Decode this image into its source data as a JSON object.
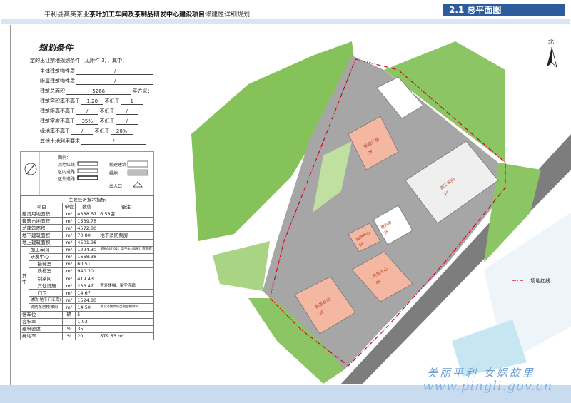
{
  "header": {
    "title_pre": "平利县高英茶业",
    "title_bold": "茶叶加工车间及茶制品研发中心建设项目",
    "title_post": "修建性详细规划",
    "section": "2.1 总平面图"
  },
  "requirements": {
    "heading": "规划条件",
    "intro": "定的出让宗地规划条件（见附件 3），其中：",
    "main_use_label": "主体建筑物性质",
    "main_use_value": "/",
    "aux_use_label": "附属建筑物性质",
    "aux_use_value": "/",
    "total_area_label": "建筑总面积",
    "total_area_value": "5266",
    "total_area_unit": "平方米；",
    "far_label": "建筑容积率不高于",
    "far_max": "1.20",
    "far_min_label": "不低于",
    "far_min": "1",
    "height_label": "建筑限高不高于",
    "height_max": "/",
    "height_min_label": "不低于",
    "height_min": "/",
    "density_label": "建筑密度不高于",
    "density_max": "35%",
    "density_min_label": "不低于",
    "density_min": "/",
    "green_label": "绿地率不高于",
    "green_max": "/",
    "green_min_label": "不低于",
    "green_min": "20%",
    "other_label": "其他土地利用要求",
    "other_value": "/"
  },
  "legend": {
    "title": "图例：",
    "red_line": "用地红线",
    "inner_road": "区内道路",
    "outer_road": "区外道路",
    "new_building": "新建建筑",
    "green": "绿地",
    "entrance": "出入口"
  },
  "table": {
    "caption": "主要经济技术指标",
    "headers": [
      "项目",
      "单位",
      "数值",
      "备注"
    ],
    "rows": [
      {
        "name": "建设用地面积",
        "unit": "m²",
        "value": "4388.67",
        "note": "6.58亩"
      },
      {
        "name": "建筑占地面积",
        "unit": "m²",
        "value": "1539.78",
        "note": ""
      },
      {
        "name": "总建筑面积",
        "unit": "m²",
        "value": "4572.80",
        "note": ""
      },
      {
        "name": "地下建筑面积",
        "unit": "m²",
        "value": "70.80",
        "note": "地下消防泵房"
      },
      {
        "name": "地上建筑面积",
        "unit": "m²",
        "value": "4501.98",
        "note": ""
      }
    ],
    "group_label": "其中",
    "sub_rows": [
      {
        "name": "加工车间",
        "unit": "m²",
        "value": "1294.30",
        "note": "单层647.02，高于8m再按计容面积"
      },
      {
        "name": "研发中心",
        "unit": "m²",
        "value": "1668.38",
        "note": ""
      }
    ],
    "inner_group": "其中",
    "inner_rows": [
      {
        "name": "接待室",
        "unit": "m²",
        "value": "60.51",
        "note": ""
      },
      {
        "name": "质检室",
        "unit": "m²",
        "value": "940.30",
        "note": ""
      },
      {
        "name": "制茶间",
        "unit": "m²",
        "value": "419.43",
        "note": ""
      },
      {
        "name": "其他设施",
        "unit": "m²",
        "value": "233.47",
        "note": "室外楼梯、架空连廊"
      }
    ],
    "more_rows": [
      {
        "name": "门卫",
        "unit": "m²",
        "value": "14.67",
        "note": ""
      },
      {
        "name": "辅助(地下厂汇库)",
        "unit": "m²",
        "value": "1524.80",
        "note": ""
      },
      {
        "name": "消防泵房楼梯间",
        "unit": "m²",
        "value": "14.50",
        "note": "地下消防泵房出地面楼梯间"
      }
    ],
    "tail_rows": [
      {
        "name": "停车位",
        "unit": "辆",
        "value": "5",
        "note": ""
      },
      {
        "name": "容积率",
        "unit": "",
        "value": "1.03",
        "note": ""
      },
      {
        "name": "建筑密度",
        "unit": "%",
        "value": "35",
        "note": ""
      },
      {
        "name": "绿地率",
        "unit": "%",
        "value": "20",
        "note": "879.83 m²"
      }
    ]
  },
  "map": {
    "north_label": "北",
    "red_line_legend": "场地红线",
    "buildings": [
      {
        "name": "加工车间",
        "floors": "1F"
      },
      {
        "name": "原料库",
        "floors": "3F"
      },
      {
        "name": "研发中心",
        "floors": "4F"
      },
      {
        "name": "制茶车间",
        "floors": "3F"
      },
      {
        "name": "接待中心",
        "floors": "1F"
      },
      {
        "name": "新建厂房",
        "floors": "3F"
      }
    ]
  },
  "watermark": {
    "line1": "美丽平利 女娲故里",
    "line2": "www.pingli.gov.cn"
  },
  "colors": {
    "header_tab": "#2d5c9c",
    "green_space": "#7cc04a",
    "road": "#9a9a9a",
    "building_pink": "#f4b8a2",
    "building_white": "#ececec",
    "red_line": "#d6001c"
  }
}
